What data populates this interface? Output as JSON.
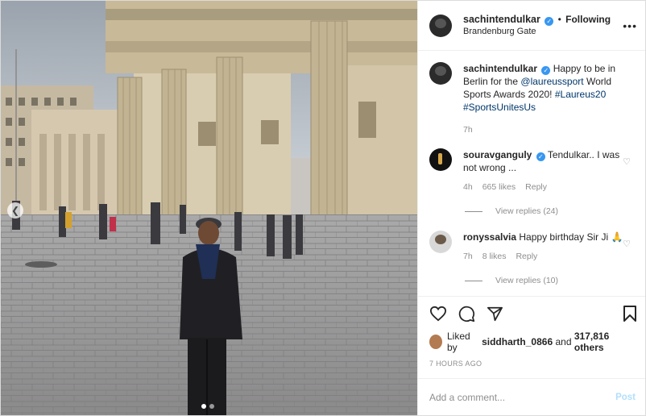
{
  "post": {
    "username": "sachintendulkar",
    "follow_label": "Following",
    "location": "Brandenburg Gate",
    "more_label": "•••"
  },
  "caption": {
    "username": "sachintendulkar",
    "text_before": "Happy to be in Berlin for the",
    "mention": "@laureussport",
    "text_after": "World Sports Awards 2020!",
    "hashtags": "#Laureus20 #SportsUnitesUs",
    "time": "7h"
  },
  "comments": [
    {
      "username": "souravganguly",
      "text": "Tendulkar.. I was not wrong ...",
      "time": "4h",
      "likes": "665 likes",
      "reply_label": "Reply",
      "view_replies": "View replies (24)"
    },
    {
      "username": "ronyssalvia",
      "text": "Happy birthday Sir Ji 🙏",
      "time": "7h",
      "likes": "8 likes",
      "reply_label": "Reply",
      "view_replies": "View replies (10)"
    }
  ],
  "likes": {
    "prefix": "Liked by",
    "user": "siddharth_0866",
    "and": "and",
    "count": "317,816 others"
  },
  "timestamp": "7 HOURS AGO",
  "add_comment": {
    "placeholder": "Add a comment...",
    "post_label": "Post"
  },
  "carousel": {
    "total": 2,
    "active": 1
  },
  "colors": {
    "link": "#00376b",
    "verified": "#3897f0",
    "post_disabled": "#b2dffc"
  },
  "icons": [
    "verified-icon",
    "more-icon",
    "heart-icon",
    "comment-icon",
    "share-icon",
    "bookmark-icon",
    "chevron-left-icon"
  ]
}
